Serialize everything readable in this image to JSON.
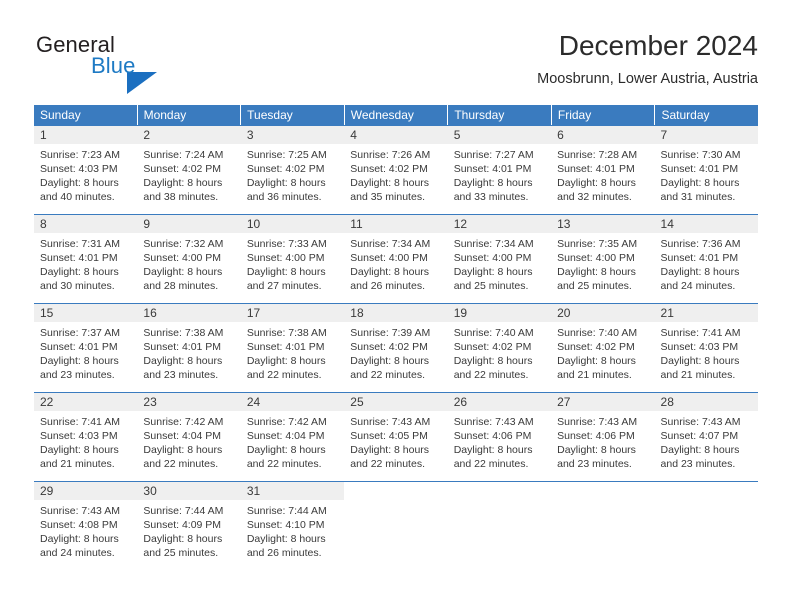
{
  "brand": {
    "name_part1": "General",
    "name_part2": "Blue",
    "triangle_color": "#1b6fc0",
    "blue_text_color": "#1e7ac4"
  },
  "header": {
    "title": "December 2024",
    "subtitle": "Moosbrunn, Lower Austria, Austria"
  },
  "theme": {
    "header_blue": "#3a7bbf",
    "daynum_bg": "#efefef",
    "text": "#3a3a3a"
  },
  "weekdays": [
    "Sunday",
    "Monday",
    "Tuesday",
    "Wednesday",
    "Thursday",
    "Friday",
    "Saturday"
  ],
  "weeks": [
    [
      {
        "day": "1",
        "sunrise": "Sunrise: 7:23 AM",
        "sunset": "Sunset: 4:03 PM",
        "daylight1": "Daylight: 8 hours",
        "daylight2": "and 40 minutes."
      },
      {
        "day": "2",
        "sunrise": "Sunrise: 7:24 AM",
        "sunset": "Sunset: 4:02 PM",
        "daylight1": "Daylight: 8 hours",
        "daylight2": "and 38 minutes."
      },
      {
        "day": "3",
        "sunrise": "Sunrise: 7:25 AM",
        "sunset": "Sunset: 4:02 PM",
        "daylight1": "Daylight: 8 hours",
        "daylight2": "and 36 minutes."
      },
      {
        "day": "4",
        "sunrise": "Sunrise: 7:26 AM",
        "sunset": "Sunset: 4:02 PM",
        "daylight1": "Daylight: 8 hours",
        "daylight2": "and 35 minutes."
      },
      {
        "day": "5",
        "sunrise": "Sunrise: 7:27 AM",
        "sunset": "Sunset: 4:01 PM",
        "daylight1": "Daylight: 8 hours",
        "daylight2": "and 33 minutes."
      },
      {
        "day": "6",
        "sunrise": "Sunrise: 7:28 AM",
        "sunset": "Sunset: 4:01 PM",
        "daylight1": "Daylight: 8 hours",
        "daylight2": "and 32 minutes."
      },
      {
        "day": "7",
        "sunrise": "Sunrise: 7:30 AM",
        "sunset": "Sunset: 4:01 PM",
        "daylight1": "Daylight: 8 hours",
        "daylight2": "and 31 minutes."
      }
    ],
    [
      {
        "day": "8",
        "sunrise": "Sunrise: 7:31 AM",
        "sunset": "Sunset: 4:01 PM",
        "daylight1": "Daylight: 8 hours",
        "daylight2": "and 30 minutes."
      },
      {
        "day": "9",
        "sunrise": "Sunrise: 7:32 AM",
        "sunset": "Sunset: 4:00 PM",
        "daylight1": "Daylight: 8 hours",
        "daylight2": "and 28 minutes."
      },
      {
        "day": "10",
        "sunrise": "Sunrise: 7:33 AM",
        "sunset": "Sunset: 4:00 PM",
        "daylight1": "Daylight: 8 hours",
        "daylight2": "and 27 minutes."
      },
      {
        "day": "11",
        "sunrise": "Sunrise: 7:34 AM",
        "sunset": "Sunset: 4:00 PM",
        "daylight1": "Daylight: 8 hours",
        "daylight2": "and 26 minutes."
      },
      {
        "day": "12",
        "sunrise": "Sunrise: 7:34 AM",
        "sunset": "Sunset: 4:00 PM",
        "daylight1": "Daylight: 8 hours",
        "daylight2": "and 25 minutes."
      },
      {
        "day": "13",
        "sunrise": "Sunrise: 7:35 AM",
        "sunset": "Sunset: 4:00 PM",
        "daylight1": "Daylight: 8 hours",
        "daylight2": "and 25 minutes."
      },
      {
        "day": "14",
        "sunrise": "Sunrise: 7:36 AM",
        "sunset": "Sunset: 4:01 PM",
        "daylight1": "Daylight: 8 hours",
        "daylight2": "and 24 minutes."
      }
    ],
    [
      {
        "day": "15",
        "sunrise": "Sunrise: 7:37 AM",
        "sunset": "Sunset: 4:01 PM",
        "daylight1": "Daylight: 8 hours",
        "daylight2": "and 23 minutes."
      },
      {
        "day": "16",
        "sunrise": "Sunrise: 7:38 AM",
        "sunset": "Sunset: 4:01 PM",
        "daylight1": "Daylight: 8 hours",
        "daylight2": "and 23 minutes."
      },
      {
        "day": "17",
        "sunrise": "Sunrise: 7:38 AM",
        "sunset": "Sunset: 4:01 PM",
        "daylight1": "Daylight: 8 hours",
        "daylight2": "and 22 minutes."
      },
      {
        "day": "18",
        "sunrise": "Sunrise: 7:39 AM",
        "sunset": "Sunset: 4:02 PM",
        "daylight1": "Daylight: 8 hours",
        "daylight2": "and 22 minutes."
      },
      {
        "day": "19",
        "sunrise": "Sunrise: 7:40 AM",
        "sunset": "Sunset: 4:02 PM",
        "daylight1": "Daylight: 8 hours",
        "daylight2": "and 22 minutes."
      },
      {
        "day": "20",
        "sunrise": "Sunrise: 7:40 AM",
        "sunset": "Sunset: 4:02 PM",
        "daylight1": "Daylight: 8 hours",
        "daylight2": "and 21 minutes."
      },
      {
        "day": "21",
        "sunrise": "Sunrise: 7:41 AM",
        "sunset": "Sunset: 4:03 PM",
        "daylight1": "Daylight: 8 hours",
        "daylight2": "and 21 minutes."
      }
    ],
    [
      {
        "day": "22",
        "sunrise": "Sunrise: 7:41 AM",
        "sunset": "Sunset: 4:03 PM",
        "daylight1": "Daylight: 8 hours",
        "daylight2": "and 21 minutes."
      },
      {
        "day": "23",
        "sunrise": "Sunrise: 7:42 AM",
        "sunset": "Sunset: 4:04 PM",
        "daylight1": "Daylight: 8 hours",
        "daylight2": "and 22 minutes."
      },
      {
        "day": "24",
        "sunrise": "Sunrise: 7:42 AM",
        "sunset": "Sunset: 4:04 PM",
        "daylight1": "Daylight: 8 hours",
        "daylight2": "and 22 minutes."
      },
      {
        "day": "25",
        "sunrise": "Sunrise: 7:43 AM",
        "sunset": "Sunset: 4:05 PM",
        "daylight1": "Daylight: 8 hours",
        "daylight2": "and 22 minutes."
      },
      {
        "day": "26",
        "sunrise": "Sunrise: 7:43 AM",
        "sunset": "Sunset: 4:06 PM",
        "daylight1": "Daylight: 8 hours",
        "daylight2": "and 22 minutes."
      },
      {
        "day": "27",
        "sunrise": "Sunrise: 7:43 AM",
        "sunset": "Sunset: 4:06 PM",
        "daylight1": "Daylight: 8 hours",
        "daylight2": "and 23 minutes."
      },
      {
        "day": "28",
        "sunrise": "Sunrise: 7:43 AM",
        "sunset": "Sunset: 4:07 PM",
        "daylight1": "Daylight: 8 hours",
        "daylight2": "and 23 minutes."
      }
    ],
    [
      {
        "day": "29",
        "sunrise": "Sunrise: 7:43 AM",
        "sunset": "Sunset: 4:08 PM",
        "daylight1": "Daylight: 8 hours",
        "daylight2": "and 24 minutes."
      },
      {
        "day": "30",
        "sunrise": "Sunrise: 7:44 AM",
        "sunset": "Sunset: 4:09 PM",
        "daylight1": "Daylight: 8 hours",
        "daylight2": "and 25 minutes."
      },
      {
        "day": "31",
        "sunrise": "Sunrise: 7:44 AM",
        "sunset": "Sunset: 4:10 PM",
        "daylight1": "Daylight: 8 hours",
        "daylight2": "and 26 minutes."
      },
      {
        "day": "",
        "sunrise": "",
        "sunset": "",
        "daylight1": "",
        "daylight2": ""
      },
      {
        "day": "",
        "sunrise": "",
        "sunset": "",
        "daylight1": "",
        "daylight2": ""
      },
      {
        "day": "",
        "sunrise": "",
        "sunset": "",
        "daylight1": "",
        "daylight2": ""
      },
      {
        "day": "",
        "sunrise": "",
        "sunset": "",
        "daylight1": "",
        "daylight2": ""
      }
    ]
  ]
}
